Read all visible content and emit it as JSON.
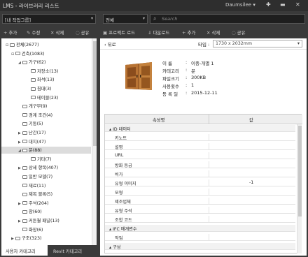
{
  "titlebar": {
    "title": "LMS - 라이브러리 리스트",
    "user": "Daumsilee",
    "user_caret": "▾",
    "icons": [
      "pin-icon",
      "minimize-icon",
      "close-icon"
    ]
  },
  "left_combo": {
    "value": "[내 작업그룹]"
  },
  "right_combo": {
    "value": "전체"
  },
  "search": {
    "placeholder": "Search"
  },
  "left_toolbar": [
    {
      "icon": "add-icon",
      "label": "추가"
    },
    {
      "icon": "edit-icon",
      "label": "수정"
    },
    {
      "icon": "delete-icon",
      "label": "삭제"
    },
    {
      "icon": "share-icon",
      "label": "공유"
    }
  ],
  "right_toolbar": [
    {
      "icon": "project-load-icon",
      "label": "프로젝트 로드"
    },
    {
      "icon": "download-icon",
      "label": "다운로드"
    },
    {
      "icon": "add-icon",
      "label": "추가"
    },
    {
      "icon": "delete-icon",
      "label": "삭제"
    },
    {
      "icon": "share-icon",
      "label": "공유"
    }
  ],
  "tree": [
    {
      "label": "전체(2677)",
      "level": 0,
      "expander": "⊟"
    },
    {
      "label": "건축(1083)",
      "level": 1,
      "expander": "⊟"
    },
    {
      "label": "가구(62)",
      "level": 2,
      "expander": "◢"
    },
    {
      "label": "저장소(13)",
      "level": 3,
      "expander": ""
    },
    {
      "label": "좌석(13)",
      "level": 3,
      "expander": ""
    },
    {
      "label": "침대(3)",
      "level": 3,
      "expander": ""
    },
    {
      "label": "테이블(23)",
      "level": 3,
      "expander": ""
    },
    {
      "label": "개구부(9)",
      "level": 2,
      "expander": ""
    },
    {
      "label": "경계 조건(4)",
      "level": 2,
      "expander": ""
    },
    {
      "label": "기둥(5)",
      "level": 2,
      "expander": ""
    },
    {
      "label": "난간(17)",
      "level": 2,
      "expander": "▶"
    },
    {
      "label": "대지(47)",
      "level": 2,
      "expander": "▶"
    },
    {
      "label": "문(88)",
      "level": 2,
      "expander": "◢",
      "selected": true
    },
    {
      "label": "기타(7)",
      "level": 3,
      "expander": ""
    },
    {
      "label": "상세 항목(407)",
      "level": 2,
      "expander": "▶"
    },
    {
      "label": "일반 모델(7)",
      "level": 2,
      "expander": ""
    },
    {
      "label": "재료(11)",
      "level": 2,
      "expander": ""
    },
    {
      "label": "제목 블록(5)",
      "level": 2,
      "expander": ""
    },
    {
      "label": "주석(204)",
      "level": 2,
      "expander": "▶"
    },
    {
      "label": "창(60)",
      "level": 2,
      "expander": ""
    },
    {
      "label": "커튼월 패널(13)",
      "level": 2,
      "expander": "▶"
    },
    {
      "label": "화장(6)",
      "level": 2,
      "expander": ""
    },
    {
      "label": "구조(323)",
      "level": 1,
      "expander": "▶"
    }
  ],
  "bottom_tabs": [
    "사용자 카테고리",
    "Revit 카테고리"
  ],
  "nav": {
    "back_label": "뒤로",
    "type_label": "타입 :",
    "type_value": "1730 x 2032mm"
  },
  "details": [
    {
      "key": "이      름",
      "value": "이중-개별 1"
    },
    {
      "key": "카테고리",
      "value": "문"
    },
    {
      "key": "파일크기",
      "value": "300KB"
    },
    {
      "key": "사용횟수",
      "value": "1"
    },
    {
      "key": "등 록 일",
      "value": "2015-12-11"
    }
  ],
  "grid": {
    "headers": [
      "속성명",
      "값"
    ],
    "rows": [
      {
        "cat": true,
        "name": "ID 데이터",
        "value": ""
      },
      {
        "name": "키노트",
        "value": ""
      },
      {
        "name": "설명",
        "value": ""
      },
      {
        "name": "URL",
        "value": ""
      },
      {
        "name": "방화 등급",
        "value": ""
      },
      {
        "name": "비가",
        "value": ""
      },
      {
        "name": "유형 이미지",
        "value": "-1"
      },
      {
        "name": "모형",
        "value": ""
      },
      {
        "name": "제조업체",
        "value": ""
      },
      {
        "name": "유형 주석",
        "value": ""
      },
      {
        "name": "조합 코드",
        "value": ""
      },
      {
        "cat": true,
        "name": "IFC 매개변수",
        "value": ""
      },
      {
        "name": "작업",
        "value": ""
      },
      {
        "cat": true,
        "name": "구성",
        "value": ""
      }
    ]
  },
  "colors": {
    "titlebar": "#2e2e2e",
    "toolbar": "#3a3a3a",
    "panel": "#ffffff",
    "selection": "#dcdcdc"
  }
}
